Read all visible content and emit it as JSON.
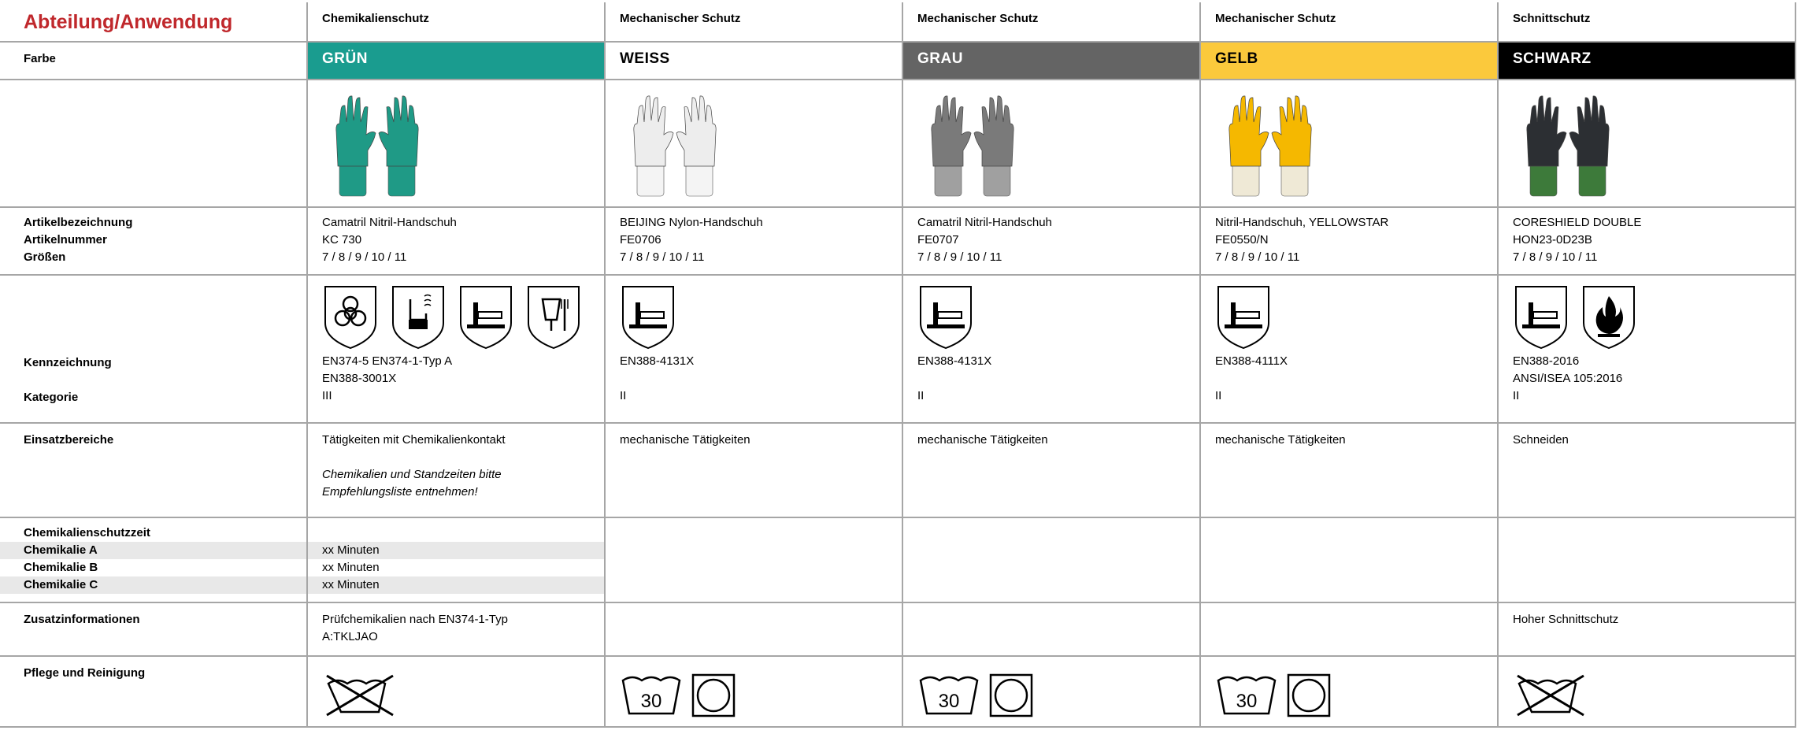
{
  "header": {
    "title": "Abteilung/Anwendung"
  },
  "columns": [
    {
      "category": "Chemikalienschutz",
      "color_name": "GRÜN",
      "color_hex": "#1a9c8f",
      "text_color": "#ffffff",
      "glove_color": "#1f9a86",
      "cuff_color": "#1f9a86",
      "name": "Camatril Nitril-Handschuh",
      "number": "KC 730",
      "sizes": "7 / 8 / 9 / 10 / 11",
      "pictograms": [
        "biohazard-icon",
        "chemical-flask-icon",
        "mechanical-hammer-icon",
        "food-safe-icon"
      ],
      "marking": [
        "EN374-5 EN374-1-Typ A",
        "EN388-3001X"
      ],
      "category_level": "III",
      "usage": "Tätigkeiten mit Chemikalienkontakt",
      "usage_note": "Chemikalien und Standzeiten bitte Empfehlungsliste entnehmen!",
      "chem_times": [
        "xx Minuten",
        "xx Minuten",
        "xx Minuten"
      ],
      "extra_info": "Prüfchemikalien nach EN374-1-Typ A:TKLJAO",
      "care": [
        "no-wash-icon"
      ]
    },
    {
      "category": "Mechanischer Schutz",
      "color_name": "WEISS",
      "color_hex": "#ffffff",
      "text_color": "#000000",
      "glove_color": "#ededed",
      "cuff_color": "#f4f4f4",
      "name": "BEIJING Nylon-Handschuh",
      "number": "FE0706",
      "sizes": "7 / 8 / 9 / 10 / 11",
      "pictograms": [
        "mechanical-hammer-icon"
      ],
      "marking": [
        "EN388-4131X"
      ],
      "category_level": "II",
      "usage": "mechanische Tätigkeiten",
      "usage_note": "",
      "chem_times": [],
      "extra_info": "",
      "care": [
        "wash-30-icon",
        "tumble-dry-icon"
      ]
    },
    {
      "category": "Mechanischer Schutz",
      "color_name": "GRAU",
      "color_hex": "#646464",
      "text_color": "#ffffff",
      "glove_color": "#7a7a7a",
      "cuff_color": "#a0a0a0",
      "name": "Camatril Nitril-Handschuh",
      "number": "FE0707",
      "sizes": "7 / 8 / 9 / 10 / 11",
      "pictograms": [
        "mechanical-hammer-icon"
      ],
      "marking": [
        "EN388-4131X"
      ],
      "category_level": "II",
      "usage": "mechanische Tätigkeiten",
      "usage_note": "",
      "chem_times": [],
      "extra_info": "",
      "care": [
        "wash-30-icon",
        "tumble-dry-icon"
      ]
    },
    {
      "category": "Mechanischer Schutz",
      "color_name": "GELB",
      "color_hex": "#fbc93c",
      "text_color": "#000000",
      "glove_color": "#f5b800",
      "cuff_color": "#efe9d6",
      "name": "Nitril-Handschuh, YELLOWSTAR",
      "number": "FE0550/N",
      "sizes": "7 / 8 / 9 / 10 / 11",
      "pictograms": [
        "mechanical-hammer-icon"
      ],
      "marking": [
        "EN388-4111X"
      ],
      "category_level": "II",
      "usage": "mechanische Tätigkeiten",
      "usage_note": "",
      "chem_times": [],
      "extra_info": "",
      "care": [
        "wash-30-icon",
        "tumble-dry-icon"
      ]
    },
    {
      "category": "Schnittschutz",
      "color_name": "SCHWARZ",
      "color_hex": "#000000",
      "text_color": "#ffffff",
      "glove_color": "#2c2f33",
      "cuff_color": "#3d7a3a",
      "name": "CORESHIELD DOUBLE",
      "number": "HON23-0D23B",
      "sizes": "7 / 8 / 9 / 10 / 11",
      "pictograms": [
        "mechanical-hammer-icon",
        "flame-icon"
      ],
      "marking": [
        "EN388-2016",
        "ANSI/ISEA 105:2016"
      ],
      "category_level": "II",
      "usage": "Schneiden",
      "usage_note": "",
      "chem_times": [],
      "extra_info": "Hoher Schnittschutz",
      "care": [
        "no-wash-icon"
      ]
    }
  ],
  "labels": {
    "farbe": "Farbe",
    "artikelbezeichnung": "Artikelbezeichnung",
    "artikelnummer": "Artikelnummer",
    "groessen": "Größen",
    "kennzeichnung": "Kennzeichnung",
    "kategorie": "Kategorie",
    "einsatzbereiche": "Einsatzbereiche",
    "chemikalienschutzzeit": "Chemikalienschutzzeit",
    "chemikalie_a": "Chemikalie A",
    "chemikalie_b": "Chemikalie B",
    "chemikalie_c": "Chemikalie C",
    "zusatzinformationen": "Zusatzinformationen",
    "pflege": "Pflege und Reinigung"
  }
}
